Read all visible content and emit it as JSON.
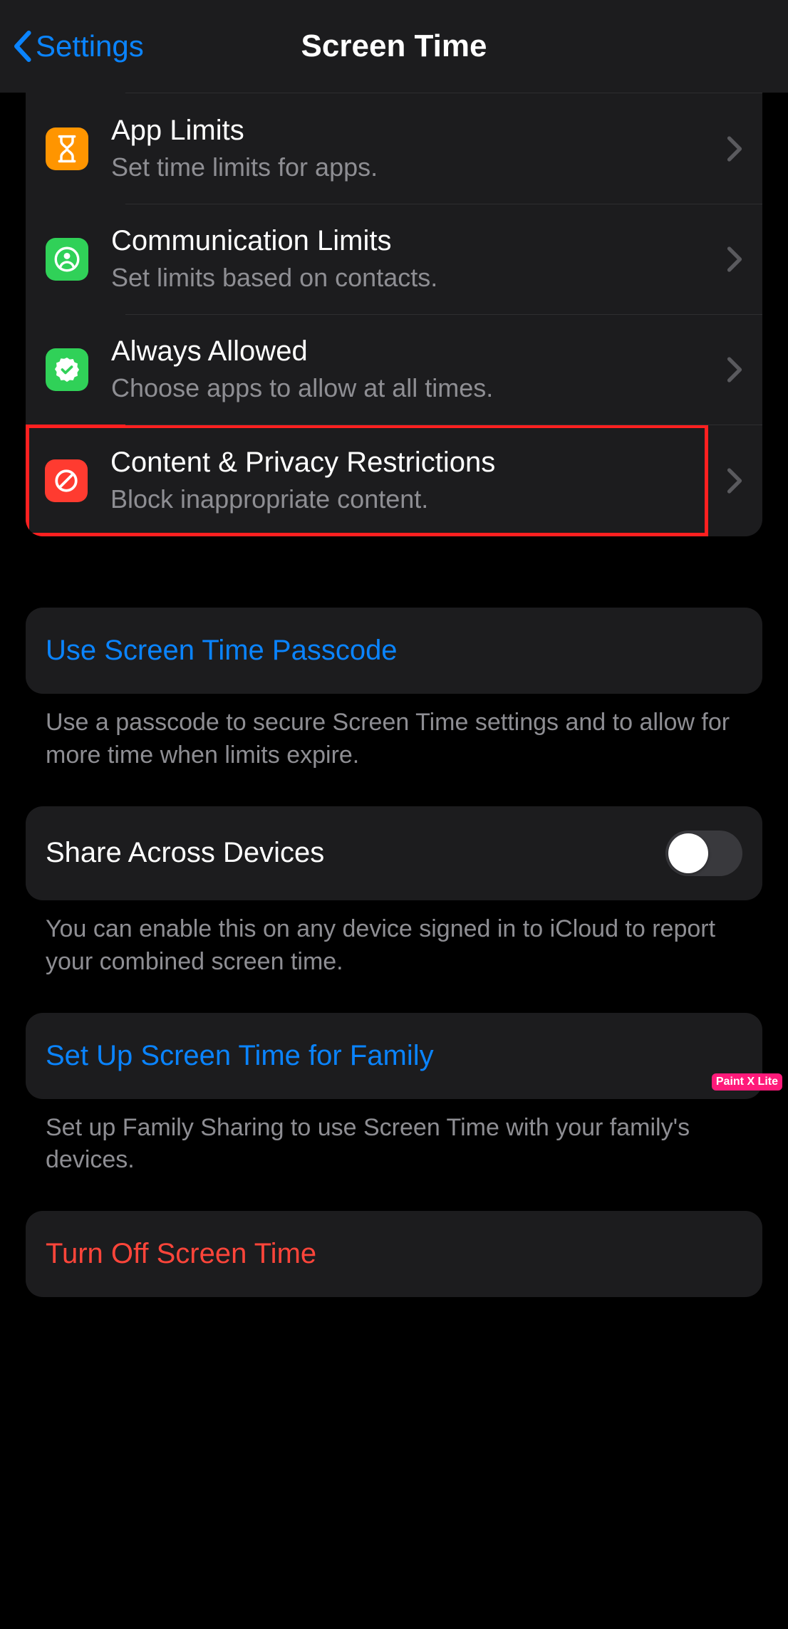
{
  "nav": {
    "back_label": "Settings",
    "title": "Screen Time"
  },
  "rows": {
    "app_limits": {
      "title": "App Limits",
      "sub": "Set time limits for apps."
    },
    "comm_limits": {
      "title": "Communication Limits",
      "sub": "Set limits based on contacts."
    },
    "always_allowed": {
      "title": "Always Allowed",
      "sub": "Choose apps to allow at all times."
    },
    "content_privacy": {
      "title": "Content & Privacy Restrictions",
      "sub": "Block inappropriate content."
    }
  },
  "passcode": {
    "action": "Use Screen Time Passcode",
    "footer": "Use a passcode to secure Screen Time settings and to allow for more time when limits expire."
  },
  "share": {
    "label": "Share Across Devices",
    "on": false,
    "footer": "You can enable this on any device signed in to iCloud to report your combined screen time."
  },
  "family": {
    "action": "Set Up Screen Time for Family",
    "footer": "Set up Family Sharing to use Screen Time with your family's devices."
  },
  "turn_off": {
    "action": "Turn Off Screen Time"
  },
  "watermark": "Paint X Lite"
}
